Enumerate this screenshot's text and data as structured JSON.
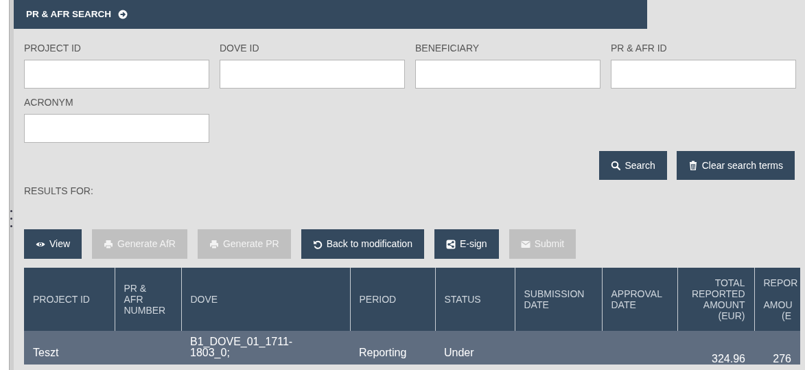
{
  "header": {
    "title": "PR & AFR SEARCH"
  },
  "search_fields": [
    {
      "label": "PROJECT ID"
    },
    {
      "label": "DOVE ID"
    },
    {
      "label": "BENEFICIARY"
    },
    {
      "label": "PR & AFR ID"
    },
    {
      "label": "ACRONYM"
    }
  ],
  "search_buttons": [
    {
      "label": "Search",
      "kind": "search"
    },
    {
      "label": "Clear search terms",
      "kind": "clear"
    }
  ],
  "results_label": "RESULTS FOR:",
  "actions": [
    {
      "label": "View",
      "kind": "view",
      "disabled": false
    },
    {
      "label": "Generate AfR",
      "kind": "print",
      "disabled": true
    },
    {
      "label": "Generate PR",
      "kind": "print",
      "disabled": true
    },
    {
      "label": "Back to modification",
      "kind": "undo",
      "disabled": false
    },
    {
      "label": "E-sign",
      "kind": "share",
      "disabled": false
    },
    {
      "label": "Submit",
      "kind": "mail",
      "disabled": true
    }
  ],
  "table": {
    "columns": [
      {
        "label": "PROJECT ID",
        "kind": "text"
      },
      {
        "label": "PR &\nAFR\nNUMBER",
        "kind": "text"
      },
      {
        "label": "DOVE",
        "kind": "text"
      },
      {
        "label": "PERIOD",
        "kind": "text"
      },
      {
        "label": "STATUS",
        "kind": "text"
      },
      {
        "label": "SUBMISSION\nDATE",
        "kind": "text"
      },
      {
        "label": "APPROVAL\nDATE",
        "kind": "text"
      },
      {
        "label": "TOTAL\nREPORTED\nAMOUNT\n(EUR)",
        "kind": "amount"
      },
      {
        "label": "REPOR\n\nAMOU\n(E",
        "kind": "amount"
      }
    ],
    "rows": [
      {
        "cells": [
          "Teszt",
          "",
          "B1_DOVE_01_1711-\n1803_0;",
          "Reporting",
          "Under",
          "",
          "",
          "324.96",
          "276"
        ]
      }
    ]
  }
}
